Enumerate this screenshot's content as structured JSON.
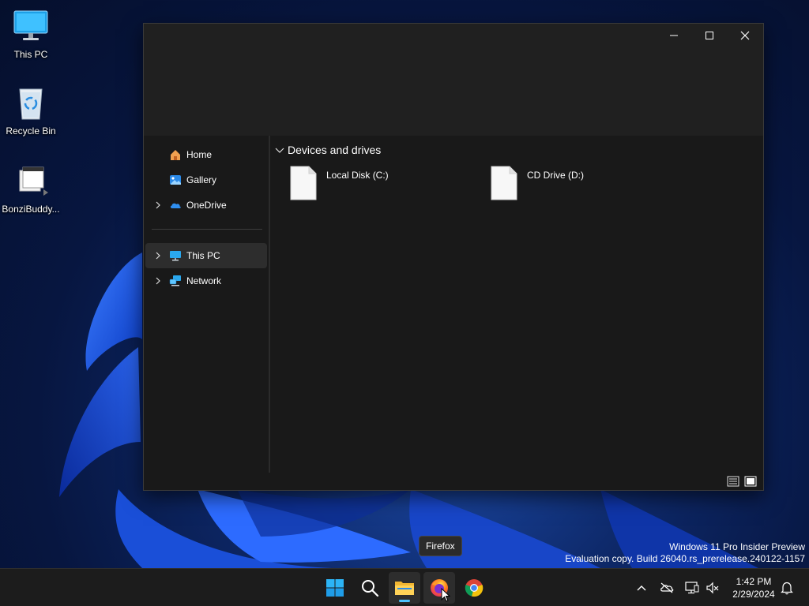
{
  "desktop": {
    "icons": [
      {
        "label": "This PC"
      },
      {
        "label": "Recycle Bin"
      },
      {
        "label": "BonziBuddy..."
      }
    ]
  },
  "explorer": {
    "nav": {
      "items": [
        {
          "label": "Home"
        },
        {
          "label": "Gallery"
        },
        {
          "label": "OneDrive"
        },
        {
          "label": "This PC"
        },
        {
          "label": "Network"
        }
      ]
    },
    "content": {
      "group_title": "Devices and drives",
      "drives": [
        {
          "label": "Local Disk (C:)"
        },
        {
          "label": "CD Drive (D:)"
        }
      ]
    }
  },
  "tooltip": {
    "text": "Firefox"
  },
  "watermark": {
    "line1": "Windows 11 Pro Insider Preview",
    "line2": "Evaluation copy. Build 26040.rs_prerelease.240122-1157"
  },
  "taskbar": {
    "apps": [
      {
        "name": "Start",
        "icon": "windows-logo-icon"
      },
      {
        "name": "Search",
        "icon": "search-icon"
      },
      {
        "name": "File Explorer",
        "icon": "folder-icon"
      },
      {
        "name": "Firefox",
        "icon": "firefox-icon"
      },
      {
        "name": "Chrome",
        "icon": "chrome-icon"
      }
    ],
    "clock": {
      "time": "1:42 PM",
      "date": "2/29/2024"
    }
  },
  "colors": {
    "accent": "#4cc2ff",
    "window_bg": "#191919",
    "titlebar_bg": "#202020"
  }
}
